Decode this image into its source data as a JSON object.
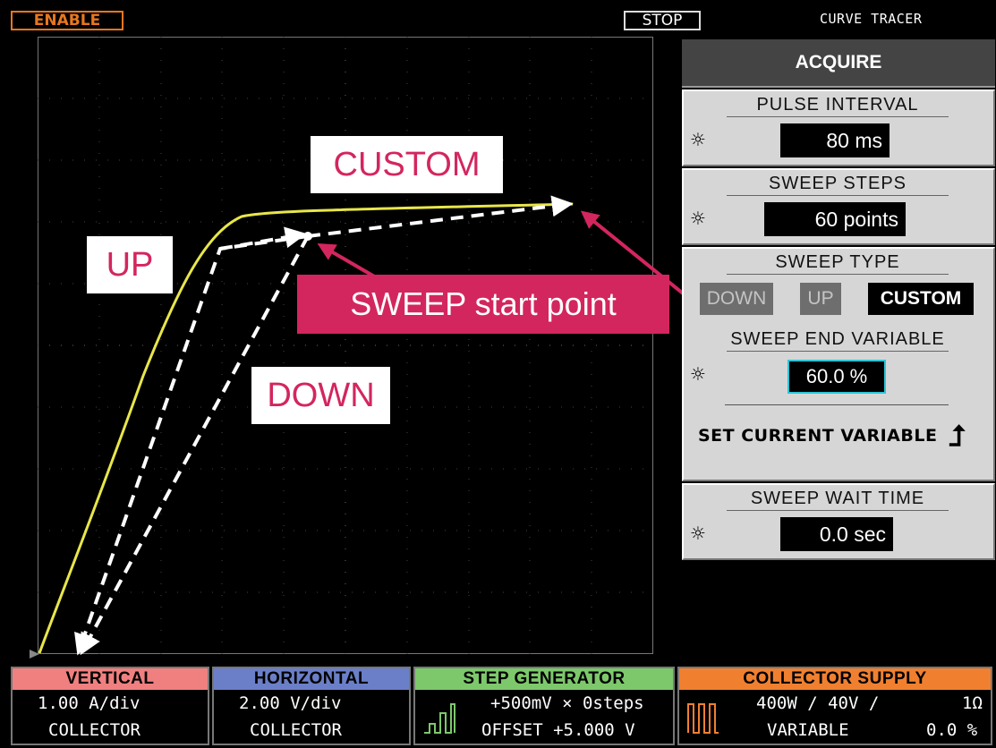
{
  "topbar": {
    "enable_label": "ENABLE",
    "stop_label": "STOP",
    "app_title": "CURVE TRACER"
  },
  "plot": {
    "annotations": {
      "custom": "CUSTOM",
      "up": "UP",
      "down": "DOWN",
      "sweep_start": "SWEEP start point"
    },
    "colors": {
      "trace": "#e8e64a",
      "callout": "#d3265e",
      "grid": "#777777"
    }
  },
  "menu": {
    "header": "ACQUIRE",
    "pulse_interval": {
      "title": "PULSE INTERVAL",
      "value": "80 ms"
    },
    "sweep_steps": {
      "title": "SWEEP STEPS",
      "value": "60 points"
    },
    "sweep_type": {
      "title": "SWEEP TYPE",
      "options": [
        "DOWN",
        "UP",
        "CUSTOM"
      ],
      "selected": "CUSTOM",
      "end_variable_title": "SWEEP END VARIABLE",
      "end_variable_value": "60.0 %",
      "set_current_label": "SET CURRENT VARIABLE"
    },
    "sweep_wait": {
      "title": "SWEEP WAIT TIME",
      "value": "0.0 sec"
    },
    "knob_icon": "knob-icon"
  },
  "bottom": {
    "vertical": {
      "title": "VERTICAL",
      "line1": "1.00 A/div",
      "line2": "COLLECTOR",
      "color": "#f08080"
    },
    "horizontal": {
      "title": "HORIZONTAL",
      "line1": "2.00 V/div",
      "line2": "COLLECTOR",
      "color": "#6b7fc8"
    },
    "step_generator": {
      "title": "STEP GENERATOR",
      "line1": "+500mV × 0steps",
      "line2": "OFFSET +5.000 V",
      "color": "#7dc86b"
    },
    "collector_supply": {
      "title": "COLLECTOR SUPPLY",
      "line1a": "400W / 40V /",
      "line1b": "1Ω",
      "line2a": "VARIABLE",
      "line2b": "0.0 %",
      "color": "#f08030"
    }
  }
}
